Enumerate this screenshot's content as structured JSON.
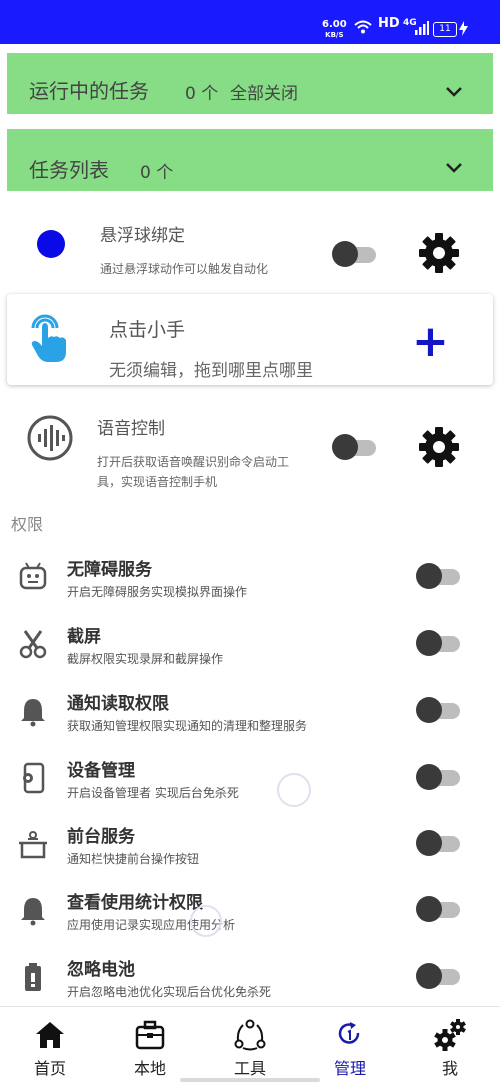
{
  "status_bar": {
    "speed_value": "6.00",
    "speed_unit": "KB/S",
    "network": "HD",
    "signal": "4G",
    "battery": "11"
  },
  "running_tasks": {
    "title": "运行中的任务",
    "count": "0 个",
    "close_all": "全部关闭"
  },
  "task_list": {
    "title": "任务列表",
    "count": "0 个"
  },
  "features": [
    {
      "title": "悬浮球绑定",
      "desc": "通过悬浮球动作可以触发自动化",
      "enabled": false,
      "dot_color": "#0a0ae6"
    },
    {
      "title": "点击小手",
      "desc": "无须编辑，拖到哪里点哪里",
      "action": "+",
      "accent": "#1515c8"
    },
    {
      "title": "语音控制",
      "desc_line1": "打开后获取语音唤醒识别命令启动工",
      "desc_line2": "具，实现语音控制手机",
      "enabled": false
    }
  ],
  "permissions_header": "权限",
  "permissions": [
    {
      "title": "无障碍服务",
      "desc": "开启无障碍服务实现模拟界面操作",
      "icon": "robot-icon",
      "enabled": false
    },
    {
      "title": "截屏",
      "desc": "截屏权限实现录屏和截屏操作",
      "icon": "scissors-icon",
      "enabled": false
    },
    {
      "title": "通知读取权限",
      "desc": "获取通知管理权限实现通知的清理和整理服务",
      "icon": "bell-icon",
      "enabled": false
    },
    {
      "title": "设备管理",
      "desc": "开启设备管理者 实现后台免杀死",
      "icon": "device-gear-icon",
      "enabled": false
    },
    {
      "title": "前台服务",
      "desc": "通知栏快捷前台操作按钮",
      "icon": "pot-icon",
      "enabled": false
    },
    {
      "title": "查看使用统计权限",
      "desc": "应用使用记录实现应用使用分析",
      "icon": "bell-icon",
      "enabled": false
    },
    {
      "title": "忽略电池",
      "desc": "开启忽略电池优化实现后台优化免杀死",
      "icon": "battery-icon",
      "enabled": false
    }
  ],
  "tabs": [
    {
      "label": "首页",
      "icon": "home-icon"
    },
    {
      "label": "本地",
      "icon": "briefcase-icon"
    },
    {
      "label": "工具",
      "icon": "share-nodes-icon"
    },
    {
      "label": "管理",
      "icon": "manage-icon",
      "active": true
    },
    {
      "label": "我",
      "icon": "gears-icon"
    }
  ],
  "colors": {
    "status_bar": "#1a1aff",
    "banner": "#86dd86",
    "active_tab": "#1a1aaa"
  }
}
